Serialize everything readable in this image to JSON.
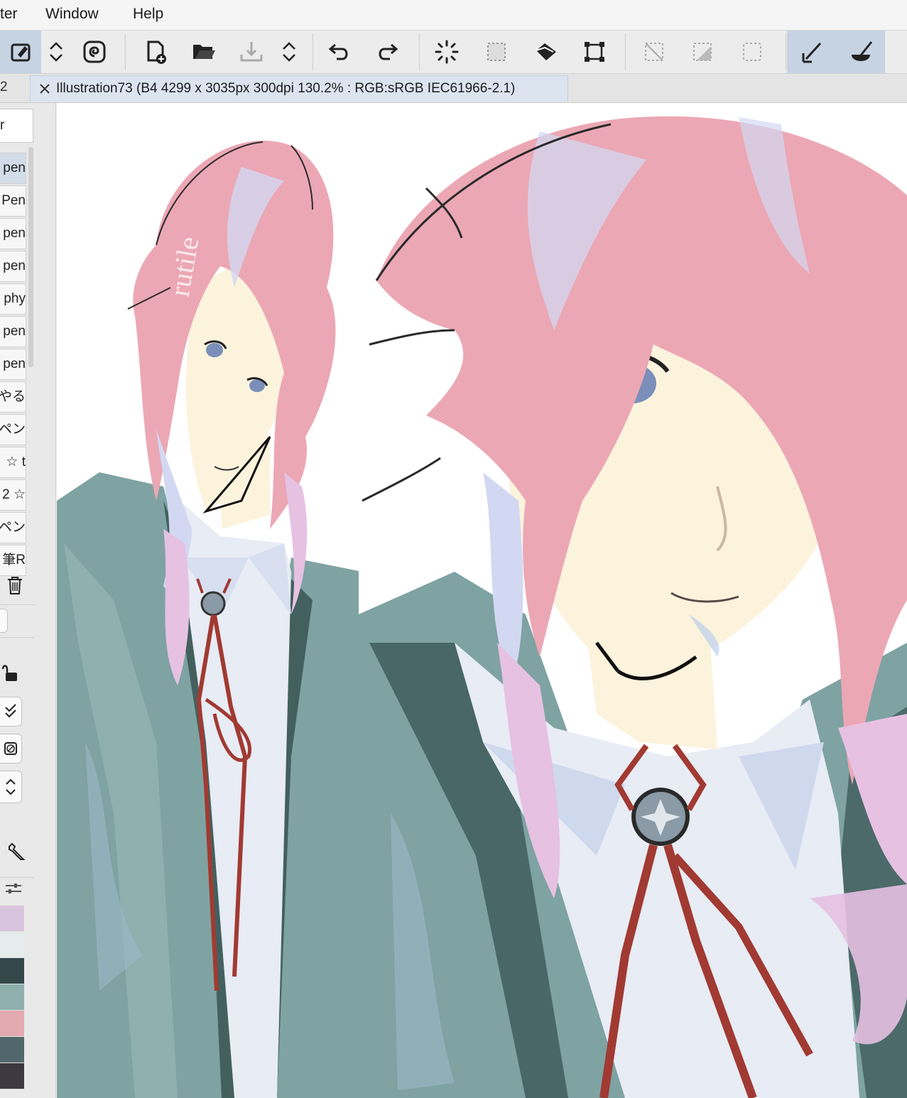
{
  "menubar": {
    "items": [
      "ter",
      "Window",
      "Help"
    ]
  },
  "toolbar": {
    "buttons": [
      "sub-tool-icon",
      "spinner-icon",
      "layer-swirl-icon",
      "new-document-icon",
      "open-folder-icon",
      "save-icon",
      "updown-icon",
      "undo-icon",
      "redo-icon",
      "select-sparkle-icon",
      "select-dotted-icon",
      "fill-bucket-icon",
      "transform-icon",
      "clear-selection-icon",
      "invert-selection-icon",
      "selection-border-icon",
      "pen-tool-icon",
      "brush-tool-icon"
    ]
  },
  "tabbar": {
    "left_num": "2",
    "document_title": "Illustration73 (B4 4299 x 3035px 300dpi 130.2% : RGB:sRGB IEC61966-2.1)"
  },
  "leftpanel": {
    "search_label": "r",
    "brushes": [
      "pen",
      "Pen",
      "pen",
      "pen",
      "phy",
      "pen",
      "pen",
      "やる",
      "ペン",
      "t ☆",
      "☆ 2",
      "ペン",
      "筆R"
    ]
  },
  "palette": {
    "colors": [
      "#d9c4dd",
      "#e6ecec",
      "#34474a",
      "#8fb0ae",
      "#e3aab0",
      "#52676b",
      "#3e3840"
    ]
  },
  "canvas": {
    "signature": "rutile",
    "colors": {
      "hair": "#eca7b4",
      "hair_shadow": "#d3d8f2",
      "skin": "#fcf3dd",
      "jacket": "#7ea3a2",
      "jacket_dark": "#43605f",
      "shirt": "#e8ecf4",
      "ribbon": "#a13a32",
      "eye": "#7b8fba"
    }
  }
}
